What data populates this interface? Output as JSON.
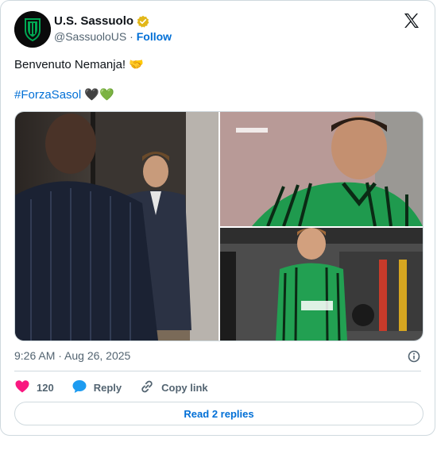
{
  "account": {
    "name": "U.S. Sassuolo",
    "handle": "@SassuoloUS",
    "separator": "·",
    "follow_label": "Follow"
  },
  "post": {
    "text": "Benvenuto Nemanja! 🤝",
    "hashtag": "#ForzaSasol",
    "hashtag_emoji": "🖤💚",
    "timestamp": "9:26 AM · Aug 26, 2025"
  },
  "stats": {
    "likes": "120",
    "reply_label": "Reply",
    "copy_link_label": "Copy link"
  },
  "footer": {
    "read_replies_label": "Read 2 replies"
  },
  "colors": {
    "link": "#006fd6",
    "like": "#f91880",
    "reply": "#1d9bf0",
    "verified": "#e2b719",
    "club_green": "#00a752"
  }
}
